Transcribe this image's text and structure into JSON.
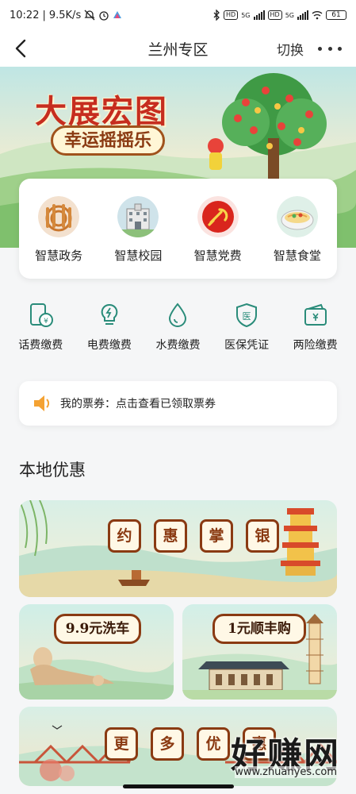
{
  "status_bar": {
    "time": "10:22",
    "net_speed": "9.5K/s",
    "net_type_1": "5G",
    "net_type_2": "5G",
    "hd_1": "HD",
    "hd_2": "HD",
    "battery": "61"
  },
  "nav": {
    "title": "兰州专区",
    "switch_label": "切换"
  },
  "banner": {
    "title": "大展宏图",
    "subtitle": "幸运摇摇乐"
  },
  "services": [
    {
      "label": "智慧政务",
      "icon": "government-icon"
    },
    {
      "label": "智慧校园",
      "icon": "campus-icon"
    },
    {
      "label": "智慧党费",
      "icon": "party-icon"
    },
    {
      "label": "智慧食堂",
      "icon": "canteen-icon"
    }
  ],
  "payments": [
    {
      "label": "话费缴费",
      "icon": "phone-bill-icon"
    },
    {
      "label": "电费缴费",
      "icon": "electricity-bill-icon"
    },
    {
      "label": "水费缴费",
      "icon": "water-bill-icon"
    },
    {
      "label": "医保凭证",
      "icon": "medical-insurance-icon"
    },
    {
      "label": "两险缴费",
      "icon": "insurance-payment-icon"
    }
  ],
  "payment_icon_text": {
    "medical": "医"
  },
  "ticket": {
    "text": "我的票券：点击查看已领取票券"
  },
  "local_section": {
    "title": "本地优惠"
  },
  "promos": {
    "main_chars": [
      "约",
      "惠",
      "掌",
      "银"
    ],
    "car_wash": "9.9元洗车",
    "sf_buy": "1元顺丰购",
    "more_chars": [
      "更",
      "多",
      "优",
      "惠"
    ]
  },
  "watermark": {
    "text": "好赚网",
    "url": "www.zhuanyes.com"
  },
  "colors": {
    "accent_red": "#c62d1f",
    "icon_teal": "#2a8c7a",
    "tag_brown": "#8a3a12"
  }
}
